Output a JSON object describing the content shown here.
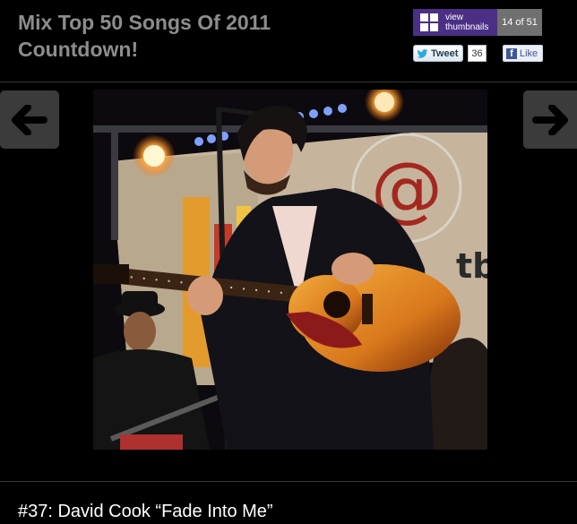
{
  "gallery": {
    "title": "Mix Top 50 Songs Of 2011 Countdown!",
    "thumbnails_label": "view thumbnails",
    "counter": "14 of 51"
  },
  "social": {
    "tweet_label": "Tweet",
    "tweet_count": "36",
    "like_label": "Like"
  },
  "photo": {
    "banner_text": "@",
    "banner_suffix": "tbu"
  },
  "caption": "#37: David Cook “Fade Into Me”",
  "colors": {
    "background": "#000000",
    "title": "#8d8d8d",
    "thumbnails_button": "#4a2f85",
    "counter": "#707070",
    "nav_button": "#3b3b3b"
  },
  "icons": [
    "grid-icon",
    "twitter-bird-icon",
    "facebook-icon",
    "arrow-left-icon",
    "arrow-right-icon"
  ]
}
